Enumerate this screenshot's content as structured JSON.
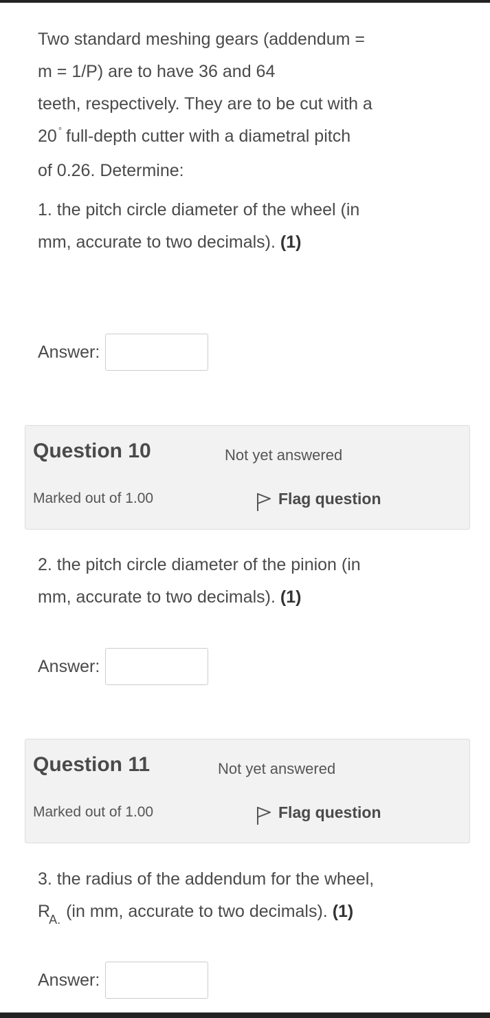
{
  "intro": {
    "line1": "Two standard meshing gears (addendum =",
    "line2": "m = 1/P) are to have 36 and 64",
    "line3": "teeth, respectively. They are to be cut with a",
    "line4_pre": "20",
    "line4_deg": "°",
    "line4_post": "full-depth cutter with a diametral pitch",
    "line5": "of 0.26. Determine:"
  },
  "parts": [
    {
      "line1": "1.  the pitch circle diameter of the wheel (in",
      "line2": "mm, accurate to two decimals).",
      "marks": "(1)",
      "answer_label": "Answer:",
      "answer_value": ""
    },
    {
      "line1": "2.  the pitch circle diameter of the pinion (in",
      "line2": "mm, accurate to two decimals).",
      "marks": "(1)",
      "answer_label": "Answer:",
      "answer_value": ""
    },
    {
      "line1": "3.  the radius of the addendum for the wheel,",
      "line2_var": "R",
      "line2_sub": "A.",
      "line2_post": "(in mm, accurate to two decimals).",
      "marks": "(1)",
      "answer_label": "Answer:",
      "answer_value": ""
    }
  ],
  "question_info": [
    {
      "number": "Question 10",
      "state": "Not yet answered",
      "grade": "Marked out of 1.00",
      "flag_label": "Flag question",
      "flag_icon": "flag-outline-icon"
    },
    {
      "number": "Question 11",
      "state": "Not yet answered",
      "grade": "Marked out of 1.00",
      "flag_label": "Flag question",
      "flag_icon": "flag-outline-icon"
    }
  ],
  "colors": {
    "text": "#4a4a4a",
    "info_bg": "#f2f2f2",
    "input_border": "#cccccc",
    "bar": "#222222"
  }
}
